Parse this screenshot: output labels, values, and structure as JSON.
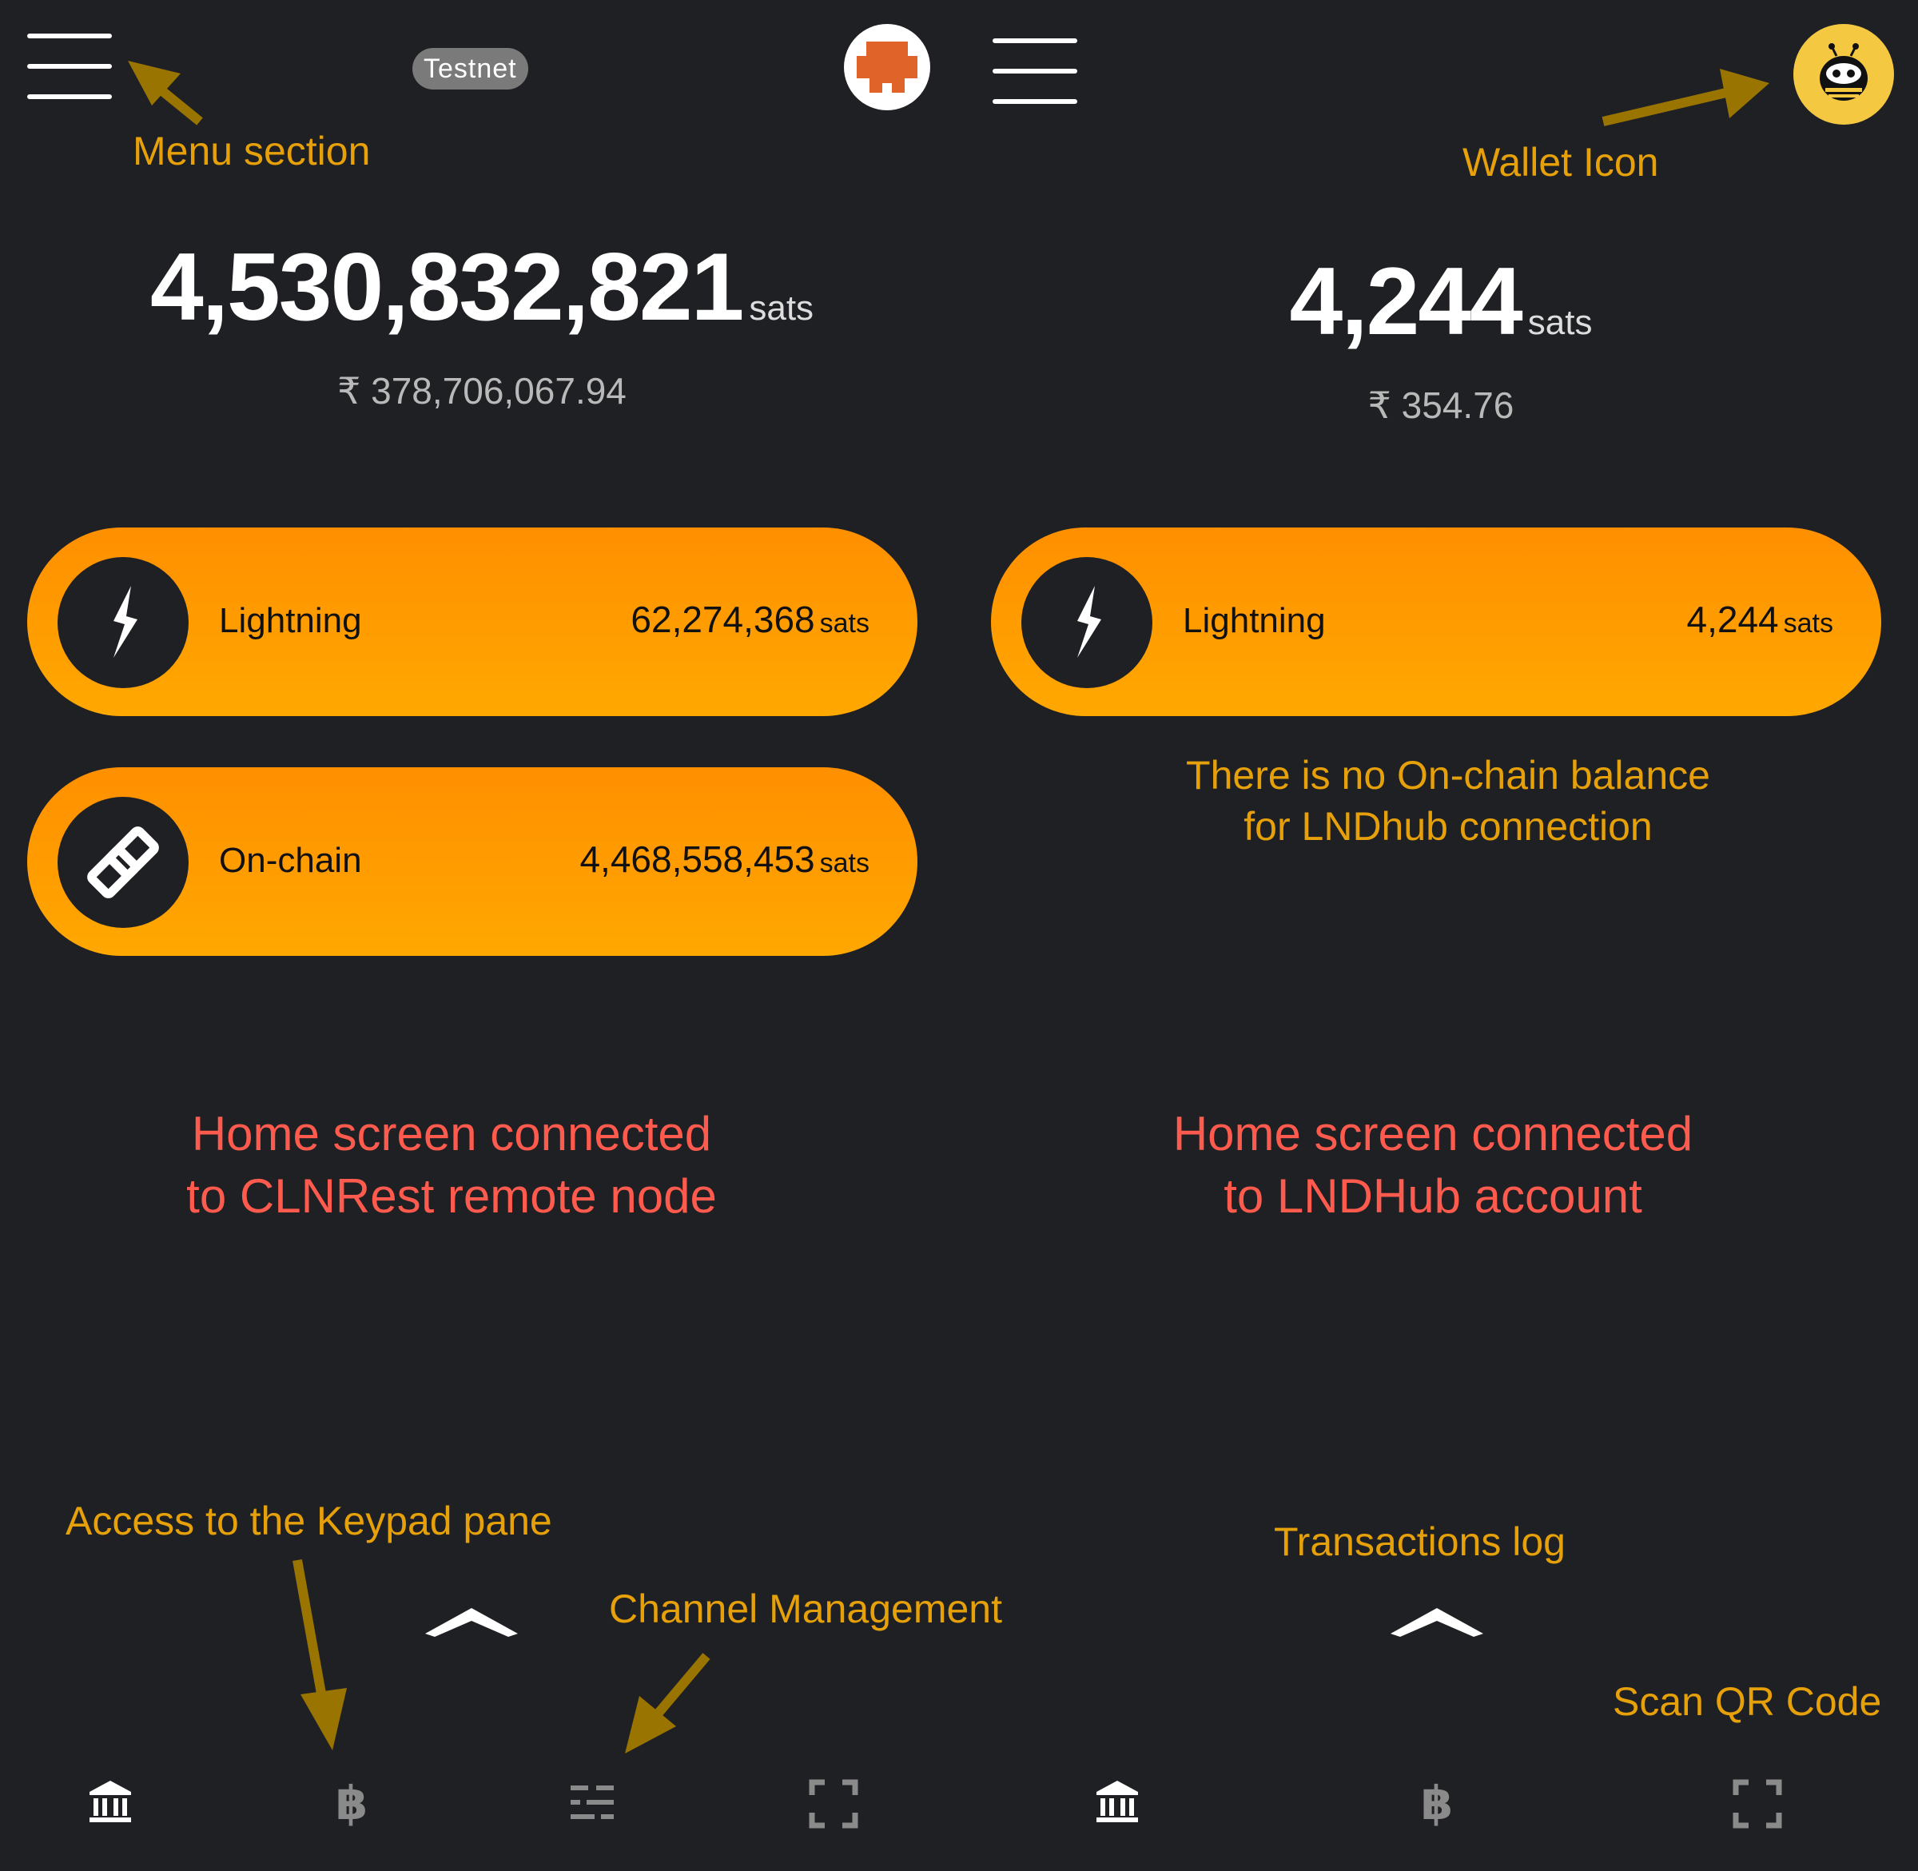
{
  "left_screen": {
    "badge": "Testnet",
    "balance": {
      "amount": "4,530,832,821",
      "unit": "sats",
      "fiat": "₹ 378,706,067.94"
    },
    "lightning": {
      "label": "Lightning",
      "amount": "62,274,368",
      "unit": "sats"
    },
    "onchain": {
      "label": "On-chain",
      "amount": "4,468,558,453",
      "unit": "sats"
    },
    "caption": [
      "Home screen connected",
      "to CLNRest remote node"
    ],
    "nav": [
      "bank-icon",
      "bitcoin-icon",
      "channels-icon",
      "scan-icon"
    ]
  },
  "right_screen": {
    "balance": {
      "amount": "4,244",
      "unit": "sats",
      "fiat": "₹ 354.76"
    },
    "lightning": {
      "label": "Lightning",
      "amount": "4,244",
      "unit": "sats"
    },
    "no_onchain_note": [
      "There is no On-chain balance",
      "for LNDhub connection"
    ],
    "caption": [
      "Home screen connected",
      "to LNDHub account"
    ],
    "nav": [
      "bank-icon",
      "bitcoin-icon",
      "scan-icon"
    ]
  },
  "annotations": {
    "menu_section": "Menu section",
    "wallet_icon": "Wallet Icon",
    "keypad": "Access to the Keypad pane",
    "channel_management": "Channel Management",
    "transactions_log": "Transactions log",
    "scan_qr": "Scan QR Code"
  },
  "colors": {
    "background": "#1f2023",
    "pill": "#ff9c00",
    "annotation": "#e6a00a",
    "caption": "#ff5a4e",
    "arrow": "#9a7400"
  }
}
